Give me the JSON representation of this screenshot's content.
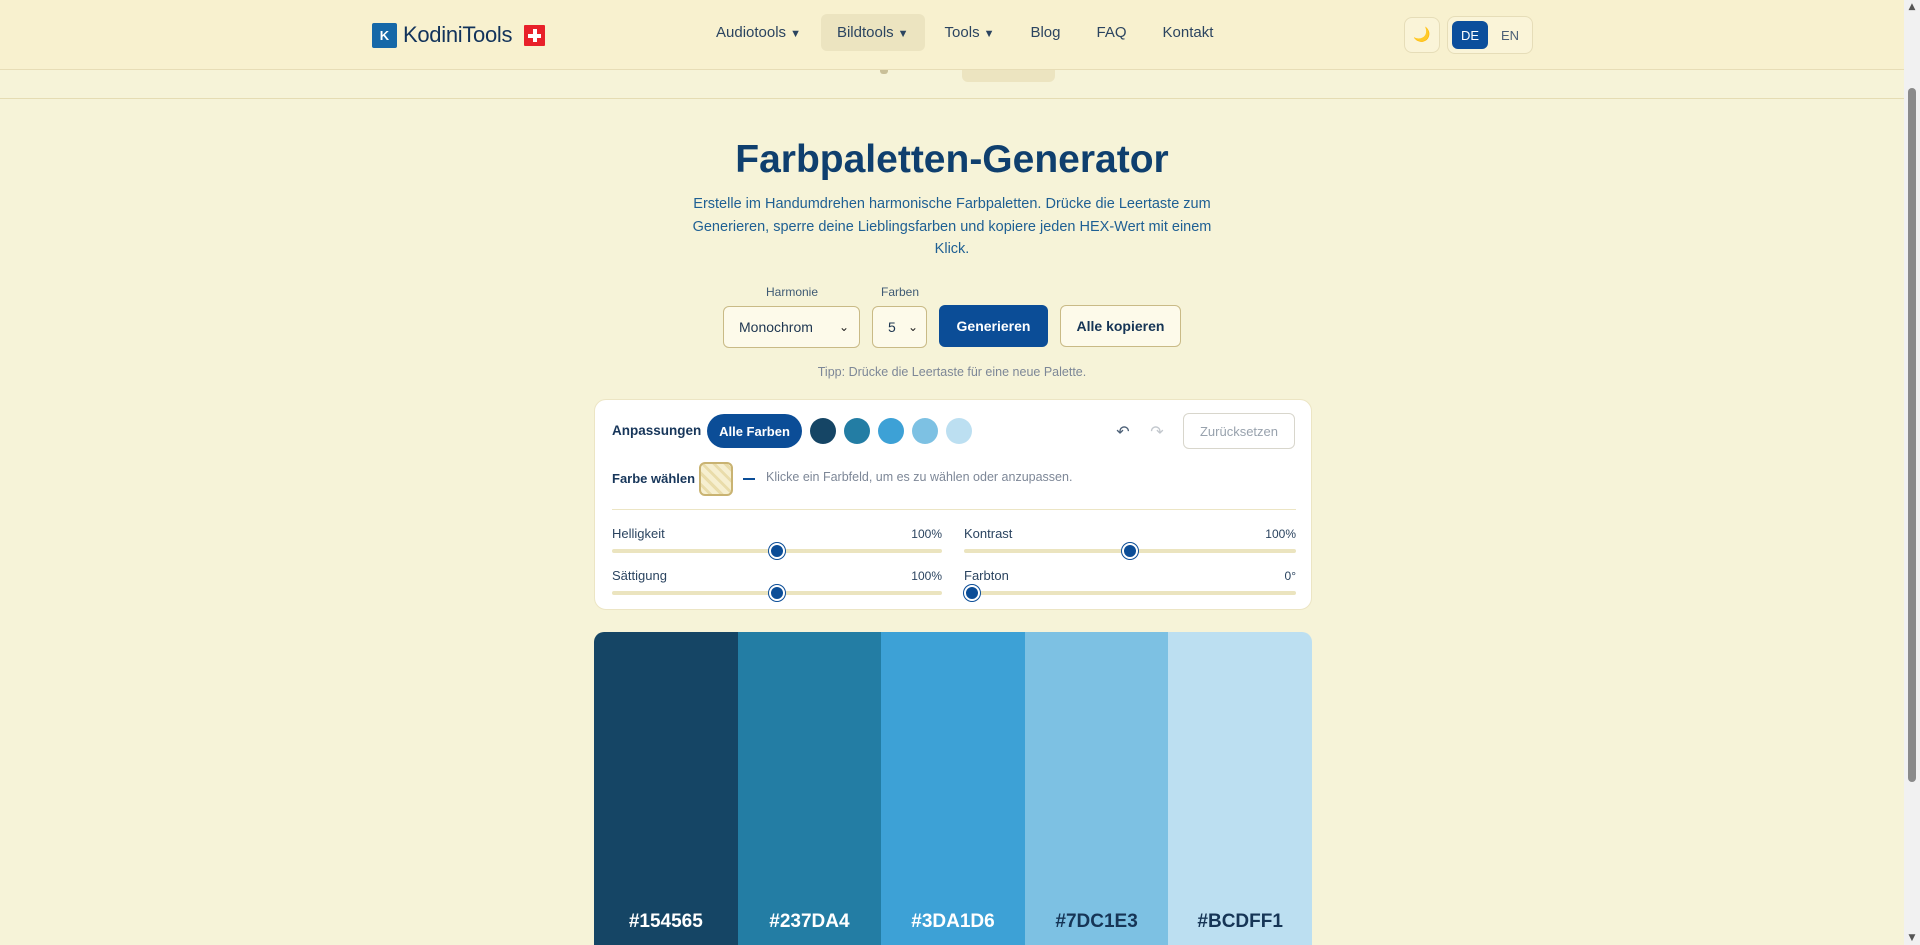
{
  "header": {
    "logo_mark": "K",
    "logo_text": "KodiniTools",
    "nav": [
      {
        "label": "Audiotools",
        "caret": "▼"
      },
      {
        "label": "Bildtools",
        "caret": "▼"
      },
      {
        "label": "Tools",
        "caret": "▼"
      },
      {
        "label": "Blog"
      },
      {
        "label": "FAQ"
      },
      {
        "label": "Kontakt"
      }
    ],
    "theme_icon": "🌙",
    "lang": [
      "DE",
      "EN"
    ]
  },
  "hero": {
    "title": "Farbpaletten-Generator",
    "subtitle": "Erstelle im Handumdrehen harmonische Farbpaletten. Drücke die Leertaste zum Generieren, sperre deine Lieblingsfarben und kopiere jeden HEX-Wert mit einem Klick."
  },
  "controls": {
    "harmony_label": "Harmonie",
    "harmony_value": "Monochrom",
    "count_label": "Farben",
    "count_value": "5",
    "generate": "Generieren",
    "copy_all": "Alle kopieren",
    "tip": "Tipp: Drücke die Leertaste für eine neue Palette."
  },
  "panel": {
    "adjust_label": "Anpassungen",
    "all_colors": "Alle Farben",
    "reset": "Zurücksetzen",
    "pick_label": "Farbe wählen",
    "pick_hint": "Klicke ein Farbfeld, um es zu wählen oder anzupassen.",
    "sliders": [
      {
        "label": "Helligkeit",
        "value": "100%",
        "fraction": 0.5
      },
      {
        "label": "Kontrast",
        "value": "100%",
        "fraction": 0.5
      },
      {
        "label": "Sättigung",
        "value": "100%",
        "fraction": 0.5
      },
      {
        "label": "Farbton",
        "value": "0°",
        "fraction": 0.0
      }
    ]
  },
  "palette": [
    {
      "hex": "#154565",
      "text": "#ffffff"
    },
    {
      "hex": "#237DA4",
      "text": "#ffffff"
    },
    {
      "hex": "#3DA1D6",
      "text": "#ffffff"
    },
    {
      "hex": "#7DC1E3",
      "text": "#163556"
    },
    {
      "hex": "#BCDFF1",
      "text": "#163556"
    }
  ]
}
